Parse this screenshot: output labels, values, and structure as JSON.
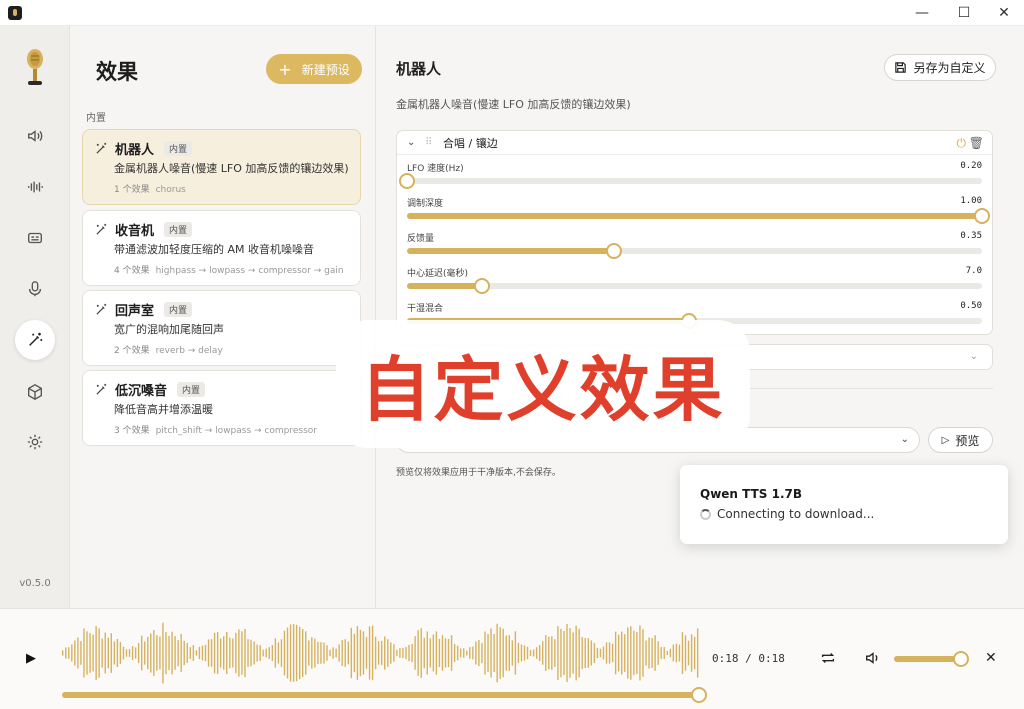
{
  "window": {
    "minimize": "—",
    "maximize": "☐",
    "close": "✕"
  },
  "rail": {
    "version": "v0.5.0",
    "items": [
      {
        "icon": "speaker-icon"
      },
      {
        "icon": "waveform-icon"
      },
      {
        "icon": "subtitles-icon"
      },
      {
        "icon": "microphone-icon"
      },
      {
        "icon": "magic-wand-icon",
        "active": true
      },
      {
        "icon": "cube-icon"
      },
      {
        "icon": "gear-icon"
      }
    ]
  },
  "list": {
    "title": "效果",
    "new_button": "新建预设",
    "new_button_icon": "+",
    "section_label": "内置",
    "presets": [
      {
        "name": "机器人",
        "badge": "内置",
        "desc": "金属机器人噪音(慢速 LFO 加高反馈的镶边效果)",
        "count": "1 个效果",
        "chain": "chorus"
      },
      {
        "name": "收音机",
        "badge": "内置",
        "desc": "带通滤波加轻度压缩的 AM 收音机噪噪音",
        "count": "4 个效果",
        "chain": "highpass → lowpass → compressor → gain"
      },
      {
        "name": "回声室",
        "badge": "内置",
        "desc": "宽广的混响加尾随回声",
        "count": "2 个效果",
        "chain": "reverb → delay"
      },
      {
        "name": "低沉嗓音",
        "badge": "内置",
        "desc": "降低音高并增添温暖",
        "count": "3 个效果",
        "chain": "pitch_shift → lowpass → compressor"
      }
    ]
  },
  "detail": {
    "title": "机器人",
    "save_as": "另存为自定义",
    "description": "金属机器人噪音(慢速 LFO 加高反馈的镶边效果)",
    "effect": {
      "name": "合唱 / 镶边",
      "params": [
        {
          "label": "LFO 速度(Hz)",
          "value": "0.20",
          "fraction": 0.0
        },
        {
          "label": "调制深度",
          "value": "1.00",
          "fraction": 1.0
        },
        {
          "label": "反馈量",
          "value": "0.35",
          "fraction": 0.36
        },
        {
          "label": "中心延迟(毫秒)",
          "value": "7.0",
          "fraction": 0.13
        },
        {
          "label": "干湿混合",
          "value": "0.50",
          "fraction": 0.49
        }
      ]
    },
    "preview_button": "预览",
    "preview_note": "预览仅将效果应用于干净版本,不会保存。"
  },
  "overlay": {
    "text": "自定义效果"
  },
  "toast": {
    "title": "Qwen TTS 1.7B",
    "status": "Connecting to download..."
  },
  "player": {
    "time": "0:18 / 0:18",
    "progress": 1.0,
    "volume": 0.95,
    "accent": "#d6b25f"
  }
}
